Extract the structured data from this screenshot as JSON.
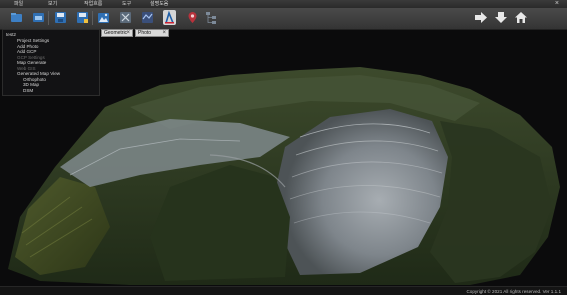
{
  "menu": {
    "items": [
      {
        "label": "파일"
      },
      {
        "label": "보기"
      },
      {
        "label": "작업흐름"
      },
      {
        "label": "도구"
      },
      {
        "label": "설명도움"
      }
    ],
    "close_symbol": "×"
  },
  "toolbar": {
    "buttons": [
      {
        "icon": "new-folder-icon"
      },
      {
        "icon": "open-folder-icon"
      },
      {
        "icon": "save-icon"
      },
      {
        "icon": "save-as-icon"
      },
      {
        "icon": "photo-import-icon"
      },
      {
        "icon": "gcp-icon"
      },
      {
        "icon": "map-generate-icon"
      },
      {
        "icon": "measure-icon"
      },
      {
        "icon": "pin-icon"
      },
      {
        "icon": "layer-tree-icon"
      }
    ],
    "nav": [
      {
        "icon": "arrow-right-icon"
      },
      {
        "icon": "arrow-down-icon"
      },
      {
        "icon": "home-icon"
      }
    ]
  },
  "tabs": [
    {
      "label": "Geometric",
      "close": "×"
    },
    {
      "label": "Photo",
      "close": "×"
    }
  ],
  "tree": {
    "root": "test2",
    "items": [
      {
        "label": "Project Settings",
        "enabled": true
      },
      {
        "label": "Add Photo",
        "enabled": true
      },
      {
        "label": "Add GCP",
        "enabled": true
      },
      {
        "label": "GCP Settings",
        "enabled": false
      },
      {
        "label": "Map Generate",
        "enabled": true
      },
      {
        "label": "Web GIS",
        "enabled": false
      },
      {
        "label": "Generated Map View",
        "enabled": true
      },
      {
        "label": "Orthophoto",
        "enabled": true
      },
      {
        "label": "3D Map",
        "enabled": true
      },
      {
        "label": "DSM",
        "enabled": true
      }
    ]
  },
  "viewport": {
    "content": "3D quarry terrain model"
  },
  "status": {
    "copyright": "Copyright © 2021 All rights reserved. Ver 1.1.1"
  },
  "colors": {
    "background": "#0b0b0c",
    "forest": "#2f3d24",
    "rock": "#8e959c",
    "accent_blue": "#2f6fb3"
  }
}
